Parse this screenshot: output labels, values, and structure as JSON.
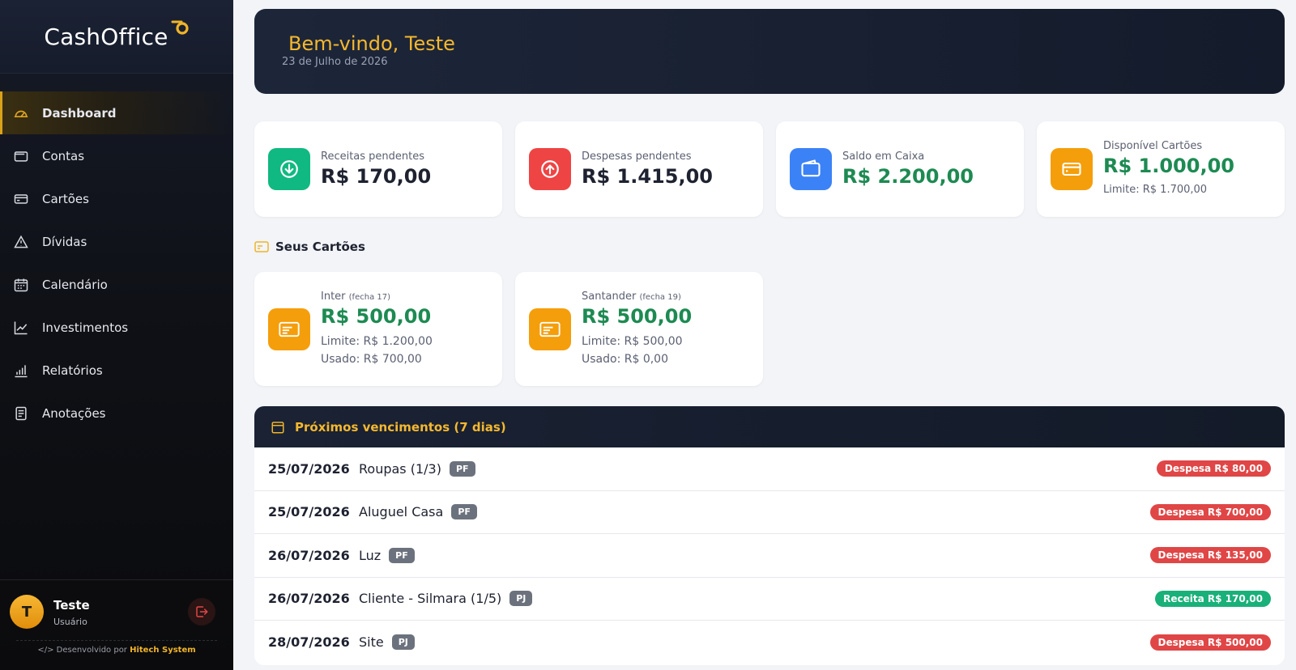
{
  "brand": {
    "name": "CashOffice"
  },
  "sidebar": {
    "items": [
      {
        "label": "Dashboard",
        "icon": "gauge-icon",
        "active": true
      },
      {
        "label": "Contas",
        "icon": "wallet-icon"
      },
      {
        "label": "Cartões",
        "icon": "credit-card-icon"
      },
      {
        "label": "Dívidas",
        "icon": "warning-icon"
      },
      {
        "label": "Calendário",
        "icon": "calendar-icon"
      },
      {
        "label": "Investimentos",
        "icon": "trend-up-icon"
      },
      {
        "label": "Relatórios",
        "icon": "bar-chart-icon"
      },
      {
        "label": "Anotações",
        "icon": "notes-icon"
      }
    ],
    "user": {
      "initial": "T",
      "name": "Teste",
      "role": "Usuário"
    },
    "footer": {
      "prefix": "</> Desenvolvido por",
      "company": "Hitech System"
    }
  },
  "welcome": {
    "title": "Bem-vindo, Teste",
    "date": "23 de Julho de 2026"
  },
  "stats": [
    {
      "label": "Receitas pendentes",
      "value": "R$ 170,00",
      "icon": "arrow-down-circle-icon",
      "color": "#10b981"
    },
    {
      "label": "Despesas pendentes",
      "value": "R$ 1.415,00",
      "icon": "arrow-up-circle-icon",
      "color": "#ef4444"
    },
    {
      "label": "Saldo em Caixa",
      "value": "R$ 2.200,00",
      "icon": "wallet-icon",
      "color": "#3b82f6"
    },
    {
      "label": "Disponível Cartões",
      "value": "R$ 1.000,00",
      "sub": "Limite: R$ 1.700,00",
      "icon": "credit-card-icon",
      "color": "#f59e0b"
    }
  ],
  "cards_section": {
    "title": "Seus Cartões"
  },
  "cards": [
    {
      "name": "Inter",
      "closing": "(fecha 17)",
      "available": "R$ 500,00",
      "limit": "Limite: R$ 1.200,00",
      "used": "Usado: R$ 700,00"
    },
    {
      "name": "Santander",
      "closing": "(fecha 19)",
      "available": "R$ 500,00",
      "limit": "Limite: R$ 500,00",
      "used": "Usado: R$ 0,00"
    }
  ],
  "upcoming": {
    "title": "Próximos vencimentos (7 dias)",
    "rows": [
      {
        "date": "25/07/2026",
        "desc": "Roupas (1/3)",
        "tag": "PF",
        "amount": "Despesa R$ 80,00",
        "kind": "despesa"
      },
      {
        "date": "25/07/2026",
        "desc": "Aluguel Casa",
        "tag": "PF",
        "amount": "Despesa R$ 700,00",
        "kind": "despesa"
      },
      {
        "date": "26/07/2026",
        "desc": "Luz",
        "tag": "PF",
        "amount": "Despesa R$ 135,00",
        "kind": "despesa"
      },
      {
        "date": "26/07/2026",
        "desc": "Cliente - Silmara (1/5)",
        "tag": "PJ",
        "amount": "Receita R$ 170,00",
        "kind": "receita"
      },
      {
        "date": "28/07/2026",
        "desc": "Site",
        "tag": "PJ",
        "amount": "Despesa R$ 500,00",
        "kind": "despesa"
      }
    ]
  }
}
